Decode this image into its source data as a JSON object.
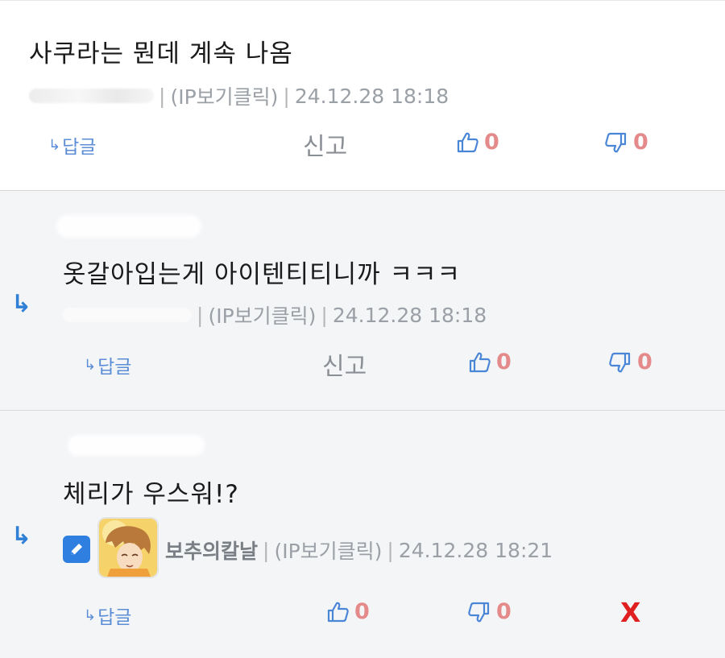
{
  "comments": [
    {
      "text": "사쿠라는 뭔데 계속 나옴",
      "meta": "(IP보기클릭)",
      "date": "24.12.28 18:18",
      "reply_label": "답글",
      "report_label": "신고",
      "likes": "0",
      "dislikes": "0"
    },
    {
      "text": "옷갈아입는게 아이텐티티니까 ㅋㅋㅋ",
      "meta": "(IP보기클릭)",
      "date": "24.12.28 18:18",
      "reply_label": "답글",
      "report_label": "신고",
      "likes": "0",
      "dislikes": "0"
    },
    {
      "text": "체리가 우스워!?",
      "nickname": "보추의칼날",
      "meta": "(IP보기클릭)",
      "date": "24.12.28 18:21",
      "reply_label": "답글",
      "likes": "0",
      "dislikes": "0",
      "delete_label": "X"
    }
  ],
  "icons": {
    "reply_arrow": "reply-arrow-icon",
    "thumbs_up": "thumbs-up-icon",
    "thumbs_down": "thumbs-down-icon",
    "edit": "pencil-icon"
  },
  "colors": {
    "accent_blue": "#2f7fd6",
    "vote_count": "#e58a8a",
    "delete": "#e02020"
  }
}
